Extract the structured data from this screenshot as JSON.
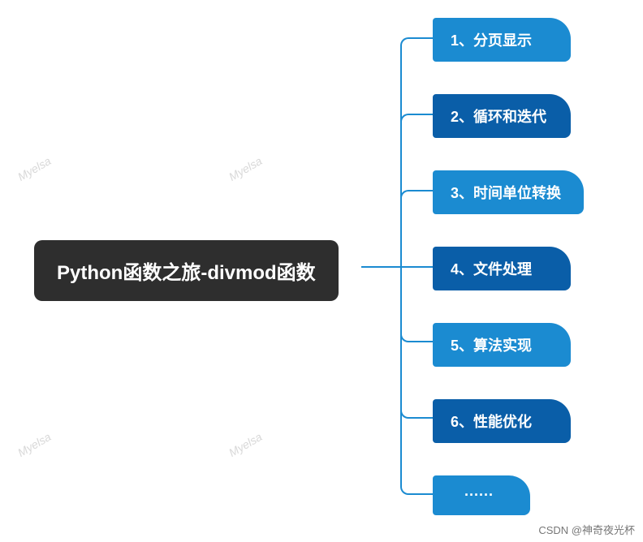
{
  "root": {
    "title": "Python函数之旅-divmod函数"
  },
  "children": [
    {
      "label": "1、分页显示"
    },
    {
      "label": "2、循环和迭代"
    },
    {
      "label": "3、时间单位转换"
    },
    {
      "label": "4、文件处理"
    },
    {
      "label": "5、算法实现"
    },
    {
      "label": "6、性能优化"
    },
    {
      "label": "······"
    }
  ],
  "watermark": "Myelsa",
  "attribution": "CSDN @神奇夜光杯",
  "colors": {
    "light": "#1b8bd1",
    "dark": "#0a5ea8",
    "root": "#2e2e2e"
  }
}
